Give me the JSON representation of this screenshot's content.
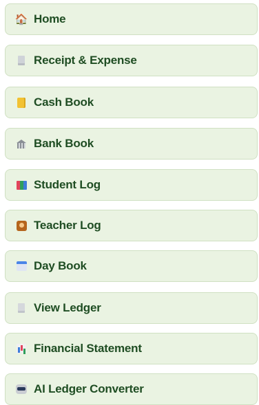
{
  "nav": {
    "items": [
      {
        "label": "Home",
        "icon": "house-icon"
      },
      {
        "label": "Receipt & Expense",
        "icon": "receipt-icon"
      },
      {
        "label": "Cash Book",
        "icon": "notebook-icon"
      },
      {
        "label": "Bank Book",
        "icon": "bank-icon"
      },
      {
        "label": "Student Log",
        "icon": "books-icon"
      },
      {
        "label": "Teacher Log",
        "icon": "teacher-icon"
      },
      {
        "label": "Day Book",
        "icon": "calendar-icon"
      },
      {
        "label": "View Ledger",
        "icon": "ledger-icon"
      },
      {
        "label": "Financial Statement",
        "icon": "bar-chart-icon"
      },
      {
        "label": "AI Ledger Converter",
        "icon": "robot-icon"
      }
    ]
  },
  "colors": {
    "item_background": "#eaf3e2",
    "item_border": "#cfe0c2",
    "label_text": "#1f4d23"
  }
}
